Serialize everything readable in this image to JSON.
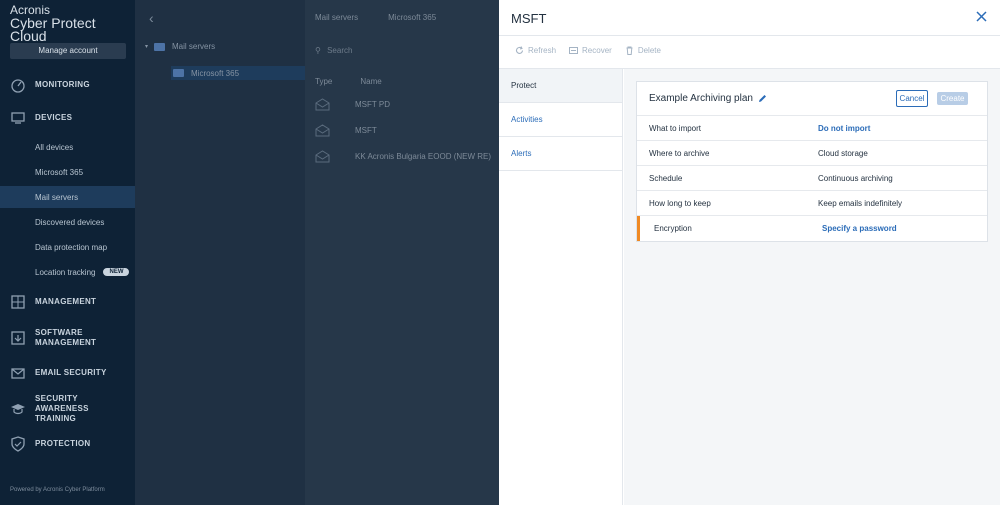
{
  "brand": {
    "line1": "Acronis",
    "line2": "Cyber Protect Cloud"
  },
  "sidebar": {
    "manage_account": "Manage account",
    "sections": [
      {
        "label": "MONITORING",
        "icon": "monitoring-icon"
      },
      {
        "label": "DEVICES",
        "icon": "devices-icon"
      },
      {
        "label": "MANAGEMENT",
        "icon": "management-icon"
      },
      {
        "label": "SOFTWARE MANAGEMENT",
        "icon": "software-management-icon"
      },
      {
        "label": "EMAIL SECURITY",
        "icon": "email-security-icon"
      },
      {
        "label": "SECURITY AWARENESS TRAINING",
        "icon": "security-awareness-icon"
      },
      {
        "label": "PROTECTION",
        "icon": "protection-icon"
      }
    ],
    "device_items": [
      {
        "label": "All devices"
      },
      {
        "label": "Microsoft 365"
      },
      {
        "label": "Mail servers",
        "active": true
      },
      {
        "label": "Discovered devices"
      },
      {
        "label": "Data protection map"
      },
      {
        "label": "Location tracking",
        "badge": "NEW"
      }
    ],
    "powered_by": "Powered by Acronis Cyber Platform"
  },
  "tree": {
    "items": [
      {
        "label": "Mail servers"
      },
      {
        "label": "Microsoft 365"
      }
    ]
  },
  "list": {
    "breadcrumb": [
      "Mail servers",
      "Microsoft 365"
    ],
    "search_placeholder": "Search",
    "columns": [
      "Type",
      "Name"
    ],
    "rows": [
      {
        "name": "MSFT PD"
      },
      {
        "name": "MSFT"
      },
      {
        "name": "KK Acronis Bulgaria EOOD (NEW RE)"
      }
    ]
  },
  "drawer": {
    "title": "MSFT",
    "toolbar": {
      "refresh": "Refresh",
      "recover": "Recover",
      "delete": "Delete"
    },
    "tabs": [
      {
        "label": "Protect",
        "active": true
      },
      {
        "label": "Activities"
      },
      {
        "label": "Alerts"
      }
    ],
    "plan": {
      "name": "Example Archiving plan",
      "cancel": "Cancel",
      "create": "Create",
      "rows": [
        {
          "key": "What to import",
          "value": "Do not import",
          "link": true
        },
        {
          "key": "Where to archive",
          "value": "Cloud storage"
        },
        {
          "key": "Schedule",
          "value": "Continuous archiving"
        },
        {
          "key": "How long to keep",
          "value": "Keep emails indefinitely"
        },
        {
          "key": "Encryption",
          "value": "Specify a password",
          "link": true,
          "warning": true
        }
      ]
    }
  },
  "colors": {
    "accent": "#2b6cb8",
    "warning": "#f08a24",
    "sidebar_bg": "#0e2236"
  }
}
